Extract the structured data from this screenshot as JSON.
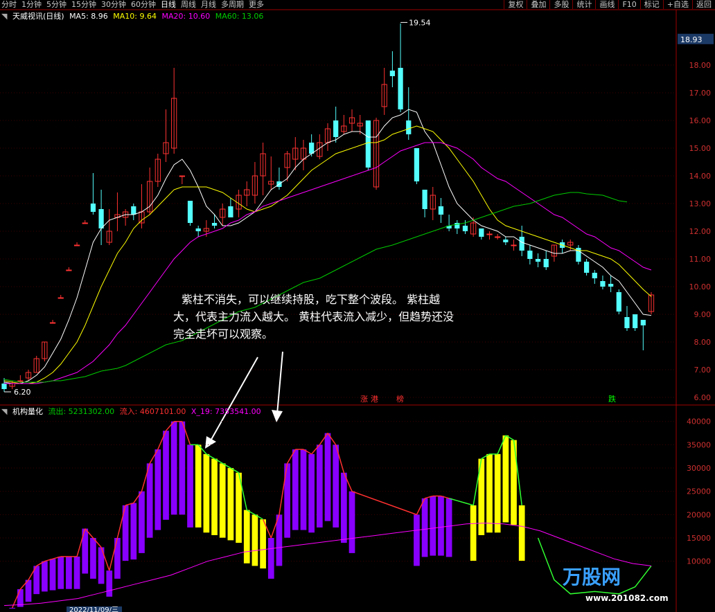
{
  "toolbar": {
    "periods": [
      "分时",
      "1分钟",
      "5分钟",
      "15分钟",
      "30分钟",
      "60分钟",
      "日线",
      "周线",
      "月线",
      "多周期",
      "更多"
    ],
    "active_period": "日线",
    "right_buttons": [
      "复权",
      "叠加",
      "多股",
      "统计",
      "画线",
      "F10",
      "标记",
      "+自选",
      "返回"
    ]
  },
  "main_legend": {
    "title": "天威视讯(日线)",
    "ma5": "MA5: 8.96",
    "ma10": "MA10: 9.64",
    "ma20": "MA20: 10.60",
    "ma60": "MA60: 13.06",
    "colors": {
      "ma5": "#ffffff",
      "ma10": "#ffff00",
      "ma20": "#ff00ff",
      "ma60": "#00cc00"
    }
  },
  "indicator_legend": {
    "title": "机构量化",
    "outflow": "流出: 5231302.00",
    "inflow": "流入: 4607101.00",
    "x19": "X_19: 7353541.00",
    "colors": {
      "outflow": "#00cc00",
      "inflow": "#ff3030",
      "x19": "#ff00ff"
    }
  },
  "price_axis": {
    "current_price": "18.93",
    "ticks": [
      "18.00",
      "17.00",
      "16.00",
      "15.00",
      "14.00",
      "13.00",
      "12.00",
      "11.00",
      "10.00",
      "9.00",
      "8.00",
      "7.00",
      "6.00"
    ]
  },
  "indicator_axis": {
    "ticks": [
      "40000",
      "35000",
      "30000",
      "25000",
      "20000",
      "15000",
      "10000"
    ]
  },
  "price_labels": {
    "high": "19.54",
    "low": "6.20"
  },
  "event_tags": [
    "涨",
    "港",
    "榜",
    "跌"
  ],
  "annotation": "紫柱不消失，可以继续持股，吃下整个波段。 紫柱越大，代表主力流入越大。 黄柱代表流入减少，但趋势还没完全走坏可以观察。",
  "watermark": {
    "brand": "万股网",
    "url": "www.201082.com"
  },
  "bottom_label": "2022/11/09/三",
  "chart_data": [
    {
      "type": "candlestick",
      "title": "天威视讯(日线)",
      "y_range": [
        5.8,
        19.6
      ],
      "candles": [
        [
          6.5,
          6.7,
          6.3,
          6.2
        ],
        [
          6.4,
          6.6,
          6.5,
          6.3
        ],
        [
          6.6,
          6.8,
          6.6,
          6.5
        ],
        [
          6.7,
          7.0,
          6.9,
          6.6
        ],
        [
          6.9,
          7.5,
          7.4,
          6.9
        ],
        [
          7.4,
          8.0,
          8.0,
          7.3
        ],
        [
          8.7,
          8.8,
          8.7,
          8.7
        ],
        [
          9.6,
          9.7,
          9.6,
          9.6
        ],
        [
          10.6,
          10.7,
          10.6,
          10.6
        ],
        [
          11.5,
          11.6,
          11.5,
          11.5
        ],
        [
          12.3,
          12.4,
          12.3,
          12.3
        ],
        [
          13.0,
          14.1,
          12.7,
          12.6
        ],
        [
          12.8,
          13.5,
          12.1,
          11.5
        ],
        [
          11.6,
          12.8,
          12.0,
          11.5
        ],
        [
          12.5,
          13.4,
          12.6,
          12.0
        ],
        [
          12.5,
          12.8,
          12.7,
          12.2
        ],
        [
          12.9,
          13.0,
          12.6,
          12.4
        ],
        [
          12.3,
          13.7,
          12.7,
          12.1
        ],
        [
          12.7,
          14.3,
          13.8,
          12.6
        ],
        [
          13.8,
          14.8,
          14.6,
          13.6
        ],
        [
          14.8,
          16.4,
          15.2,
          14.5
        ],
        [
          15.0,
          17.9,
          16.8,
          14.8
        ],
        [
          14.0,
          14.0,
          14.0,
          13.7
        ],
        [
          13.1,
          13.0,
          12.3,
          12.2
        ],
        [
          12.1,
          12.2,
          12.0,
          11.8
        ],
        [
          12.0,
          12.4,
          12.1,
          11.8
        ],
        [
          12.3,
          12.6,
          12.2,
          12.1
        ],
        [
          12.5,
          13.0,
          12.8,
          12.2
        ],
        [
          12.9,
          13.2,
          12.5,
          12.5
        ],
        [
          12.8,
          13.5,
          13.3,
          12.5
        ],
        [
          13.3,
          13.8,
          13.5,
          12.9
        ],
        [
          13.3,
          14.5,
          14.0,
          13.0
        ],
        [
          14.0,
          15.2,
          14.8,
          13.3
        ],
        [
          13.7,
          14.7,
          13.8,
          13.5
        ],
        [
          13.8,
          14.3,
          13.6,
          13.5
        ],
        [
          14.3,
          14.9,
          14.8,
          13.8
        ],
        [
          14.6,
          15.4,
          15.0,
          14.2
        ],
        [
          14.6,
          15.3,
          15.0,
          14.2
        ],
        [
          15.2,
          15.5,
          14.8,
          14.7
        ],
        [
          14.7,
          15.5,
          15.2,
          14.6
        ],
        [
          15.2,
          15.9,
          15.7,
          14.9
        ],
        [
          16.0,
          16.5,
          15.4,
          15.2
        ],
        [
          15.6,
          16.2,
          15.8,
          15.5
        ],
        [
          15.9,
          16.4,
          16.1,
          15.6
        ],
        [
          15.8,
          16.2,
          15.9,
          15.5
        ],
        [
          16.0,
          16.0,
          14.3,
          14.2
        ],
        [
          13.6,
          16.1,
          16.0,
          13.5
        ],
        [
          16.5,
          17.9,
          17.3,
          16.2
        ],
        [
          17.8,
          18.5,
          17.6,
          17.2
        ],
        [
          17.9,
          19.5,
          16.4,
          16.3
        ],
        [
          16.0,
          17.2,
          15.5,
          15.3
        ],
        [
          15.0,
          15.0,
          13.8,
          13.7
        ],
        [
          13.5,
          13.5,
          12.8,
          12.5
        ],
        [
          12.8,
          13.6,
          13.3,
          12.4
        ],
        [
          12.9,
          13.2,
          12.6,
          12.3
        ],
        [
          12.2,
          12.6,
          12.1,
          12.0
        ],
        [
          12.3,
          12.4,
          12.1,
          11.9
        ],
        [
          12.2,
          12.4,
          12.0,
          11.9
        ],
        [
          11.9,
          12.5,
          12.3,
          11.8
        ],
        [
          12.1,
          12.1,
          11.8,
          11.7
        ],
        [
          11.9,
          12.0,
          11.9,
          11.7
        ],
        [
          11.8,
          11.9,
          11.8,
          11.7
        ],
        [
          11.7,
          11.8,
          11.6,
          11.5
        ],
        [
          11.5,
          11.7,
          11.5,
          11.3
        ],
        [
          11.8,
          12.2,
          11.3,
          11.1
        ],
        [
          11.3,
          11.5,
          11.0,
          10.8
        ],
        [
          11.0,
          11.2,
          10.9,
          10.7
        ],
        [
          11.0,
          11.3,
          10.7,
          10.6
        ],
        [
          11.1,
          11.5,
          11.5,
          10.9
        ],
        [
          11.6,
          11.7,
          11.4,
          11.2
        ],
        [
          11.5,
          11.7,
          11.6,
          11.3
        ],
        [
          11.4,
          11.5,
          10.9,
          10.8
        ],
        [
          10.9,
          11.0,
          10.5,
          10.4
        ],
        [
          10.5,
          10.6,
          10.3,
          10.1
        ],
        [
          10.2,
          10.4,
          10.0,
          9.9
        ],
        [
          10.1,
          10.4,
          10.0,
          9.8
        ],
        [
          9.8,
          9.9,
          9.1,
          9.0
        ],
        [
          8.9,
          9.3,
          8.5,
          8.4
        ],
        [
          9.0,
          9.0,
          8.5,
          8.4
        ],
        [
          8.8,
          8.8,
          8.6,
          7.7
        ],
        [
          9.1,
          9.8,
          9.7,
          9.0
        ]
      ],
      "ma_series": [
        {
          "name": "MA5",
          "values": [
            6.55,
            6.5,
            6.5,
            6.6,
            6.8,
            7.1,
            7.6,
            8.1,
            8.8,
            9.6,
            10.6,
            11.6,
            12.1,
            12.4,
            12.5,
            12.6,
            12.6,
            12.7,
            12.9,
            13.3,
            13.9,
            14.4,
            14.6,
            14.2,
            13.6,
            12.9,
            12.6,
            12.2,
            12.2,
            12.3,
            12.5,
            12.7,
            13.1,
            13.5,
            13.7,
            13.9,
            14.3,
            14.6,
            14.8,
            15.0,
            15.2,
            15.3,
            15.5,
            15.6,
            15.6,
            15.4,
            15.4,
            15.8,
            16.1,
            16.2,
            16.4,
            16.3,
            15.6,
            15.2,
            14.4,
            13.6,
            13.0,
            12.7,
            12.4,
            12.2,
            12.1,
            12.0,
            11.8,
            11.8,
            11.6,
            11.5,
            11.4,
            11.3,
            11.2,
            11.2,
            11.3,
            11.3,
            11.1,
            10.9,
            10.7,
            10.4,
            10.2,
            9.8,
            9.4,
            9.0,
            8.96
          ]
        },
        {
          "name": "MA10",
          "values": [
            6.6,
            6.55,
            6.5,
            6.5,
            6.55,
            6.7,
            6.9,
            7.2,
            7.6,
            8.0,
            8.6,
            9.3,
            10.0,
            10.6,
            11.2,
            11.6,
            12.1,
            12.4,
            12.6,
            12.9,
            13.2,
            13.5,
            13.6,
            13.6,
            13.6,
            13.6,
            13.5,
            13.4,
            13.2,
            13.0,
            12.8,
            12.7,
            12.8,
            12.9,
            13.1,
            13.3,
            13.6,
            13.9,
            14.2,
            14.4,
            14.6,
            14.8,
            14.9,
            15.0,
            15.1,
            15.2,
            15.2,
            15.3,
            15.5,
            15.6,
            15.7,
            15.8,
            15.7,
            15.6,
            15.3,
            15.0,
            14.6,
            14.2,
            13.8,
            13.3,
            12.8,
            12.4,
            12.2,
            12.1,
            12.0,
            11.9,
            11.8,
            11.7,
            11.6,
            11.5,
            11.4,
            11.3,
            11.3,
            11.2,
            11.1,
            11.0,
            10.8,
            10.5,
            10.2,
            9.9,
            9.64
          ]
        },
        {
          "name": "MA20",
          "values": [
            6.5,
            6.5,
            6.5,
            6.5,
            6.5,
            6.55,
            6.6,
            6.7,
            6.8,
            6.9,
            7.1,
            7.3,
            7.6,
            7.9,
            8.3,
            8.6,
            9.0,
            9.4,
            9.8,
            10.2,
            10.6,
            11.0,
            11.3,
            11.6,
            11.8,
            11.9,
            12.0,
            12.1,
            12.3,
            12.4,
            12.6,
            12.7,
            12.9,
            13.0,
            13.1,
            13.2,
            13.3,
            13.4,
            13.5,
            13.6,
            13.7,
            13.8,
            13.9,
            14.0,
            14.1,
            14.2,
            14.3,
            14.5,
            14.7,
            14.9,
            15.0,
            15.1,
            15.2,
            15.2,
            15.2,
            15.1,
            15.0,
            14.8,
            14.6,
            14.3,
            14.1,
            13.9,
            13.8,
            13.6,
            13.4,
            13.2,
            13.0,
            12.8,
            12.6,
            12.5,
            12.3,
            12.1,
            11.9,
            11.8,
            11.6,
            11.4,
            11.3,
            11.1,
            10.9,
            10.7,
            10.6
          ]
        },
        {
          "name": "MA60",
          "values": [
            6.65,
            6.6,
            6.55,
            6.55,
            6.55,
            6.6,
            6.6,
            6.65,
            6.7,
            6.75,
            6.85,
            6.95,
            7.05,
            7.15,
            7.3,
            7.45,
            7.6,
            7.75,
            7.9,
            8.05,
            8.2,
            8.35,
            8.5,
            8.65,
            8.8,
            8.95,
            9.1,
            9.25,
            9.4,
            9.55,
            9.7,
            9.85,
            10.0,
            10.15,
            10.3,
            10.45,
            10.6,
            10.75,
            10.9,
            11.05,
            11.2,
            11.35,
            11.5,
            11.6,
            11.7,
            11.8,
            11.9,
            12.0,
            12.1,
            12.2,
            12.3,
            12.4,
            12.5,
            12.6,
            12.7,
            12.8,
            12.9,
            13.0,
            13.1,
            13.2,
            13.3,
            13.35,
            13.4,
            13.4,
            13.35,
            13.3,
            13.2,
            13.1,
            13.06
          ]
        }
      ]
    },
    {
      "type": "bar",
      "title": "机构量化",
      "y_range": [
        0,
        41000
      ],
      "bars": [
        {
          "v": [
            0,
            4000,
            6000,
            9000,
            10000,
            10500,
            11000,
            11000,
            11000,
            17000,
            15000,
            13000,
            8000,
            15000,
            22000,
            22500,
            25000,
            31000,
            34000,
            38000,
            40000,
            40000,
            35000
          ],
          "color": "#8800ff"
        },
        {
          "v": [
            35000,
            33000,
            32000,
            31000,
            30000,
            29000,
            21000,
            20000,
            19000
          ],
          "color": "#ffff00"
        },
        {
          "v": [
            15000,
            20000,
            31000,
            34000,
            34000,
            33000,
            35000,
            37500,
            35000,
            29000,
            25000
          ],
          "color": "#8800ff"
        },
        {
          "v": [
            20000,
            23500,
            24000,
            24000,
            23500
          ],
          "color": "#8800ff"
        },
        {
          "v": [
            22000,
            32000,
            33000,
            33000,
            37000,
            36000,
            22000
          ],
          "color": "#ffff00"
        }
      ],
      "lines": [
        {
          "name": "X_19",
          "color": "#ff00ff",
          "values": [
            500,
            700,
            1000,
            1500,
            2000,
            3000,
            4000,
            5000,
            6000,
            7000,
            8500,
            10000,
            11000,
            12000,
            12500,
            13000,
            13500,
            14000,
            14500,
            15000,
            15500,
            16000,
            16500,
            17000,
            17500,
            18000,
            18200,
            18000,
            17500,
            16500,
            15000,
            13500,
            12000,
            10500,
            9500,
            9000
          ]
        }
      ]
    }
  ]
}
